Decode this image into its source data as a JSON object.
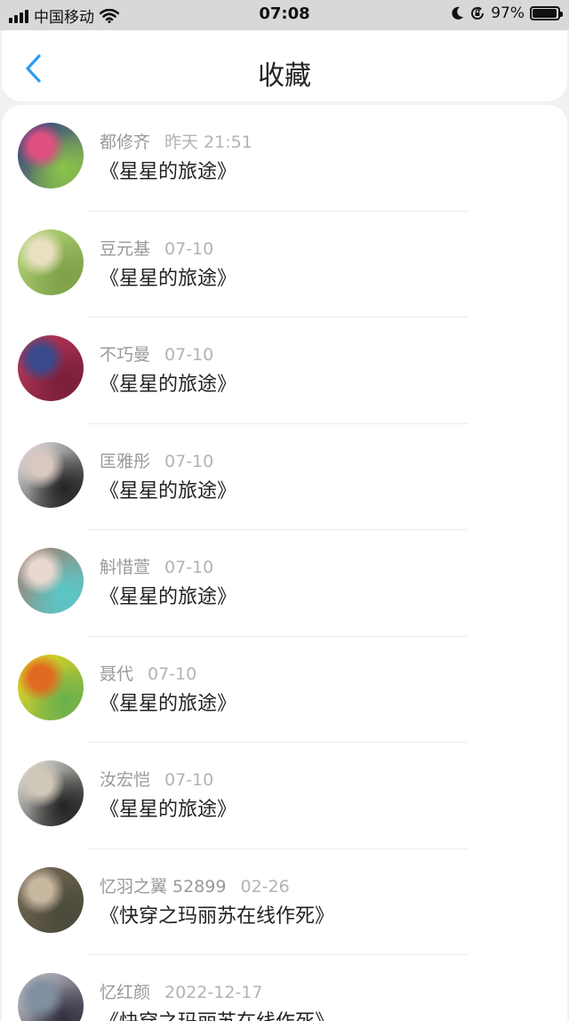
{
  "status_bar": {
    "carrier": "中国移动",
    "time": "07:08",
    "battery_text": "97%",
    "battery_level": 0.97,
    "icons": [
      "signal-icon",
      "wifi-icon",
      "moon-icon",
      "rotation-lock-icon",
      "battery-icon"
    ]
  },
  "header": {
    "title": "收藏",
    "back_icon": "chevron-left-icon",
    "accent_color": "#2a9df4"
  },
  "items": [
    {
      "name": "都修齐",
      "date": "昨天 21:51",
      "book": "《星星的旅途》",
      "avatar_palette": [
        "#2b2f8a",
        "#8bc34a",
        "#e05080"
      ]
    },
    {
      "name": "豆元基",
      "date": "07-10",
      "book": "《星星的旅途》",
      "avatar_palette": [
        "#b9d87a",
        "#7da048",
        "#e8e0c0"
      ]
    },
    {
      "name": "不巧曼",
      "date": "07-10",
      "book": "《星星的旅途》",
      "avatar_palette": [
        "#c0395a",
        "#7a1f3a",
        "#3a4a8a"
      ]
    },
    {
      "name": "匡雅彤",
      "date": "07-10",
      "book": "《星星的旅途》",
      "avatar_palette": [
        "#f2f2f2",
        "#222222",
        "#d8c8c0"
      ]
    },
    {
      "name": "斛惜萱",
      "date": "07-10",
      "book": "《星星的旅途》",
      "avatar_palette": [
        "#a47a6a",
        "#5ac8c8",
        "#e8d8d0"
      ]
    },
    {
      "name": "聂代",
      "date": "07-10",
      "book": "《星星的旅途》",
      "avatar_palette": [
        "#f5d820",
        "#6ab04c",
        "#e06a20"
      ]
    },
    {
      "name": "汝宏恺",
      "date": "07-10",
      "book": "《星星的旅途》",
      "avatar_palette": [
        "#f0f0ea",
        "#222222",
        "#d0c8b8"
      ]
    },
    {
      "name": "忆羽之翼 52899",
      "date": "02-26",
      "book": "《快穿之玛丽苏在线作死》",
      "avatar_palette": [
        "#7a6a5a",
        "#4a4a3a",
        "#c8b8a0"
      ]
    },
    {
      "name": "忆红颜",
      "date": "2022-12-17",
      "book": "《快穿之玛丽苏在线作死》",
      "avatar_palette": [
        "#d0d0d8",
        "#303040",
        "#8090a0"
      ]
    }
  ]
}
